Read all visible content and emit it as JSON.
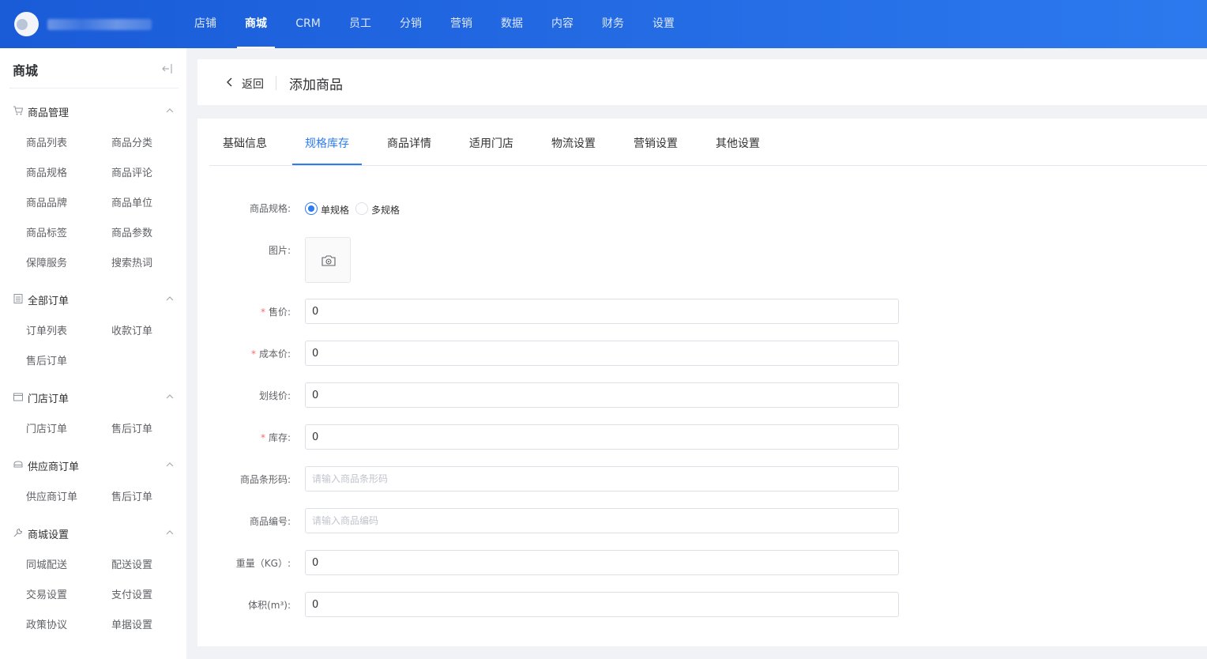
{
  "topnav": {
    "items": [
      "店铺",
      "商城",
      "CRM",
      "员工",
      "分销",
      "营销",
      "数据",
      "内容",
      "财务",
      "设置"
    ],
    "active": "商城"
  },
  "sidebar": {
    "title": "商城",
    "groups": [
      {
        "label": "商品管理",
        "icon": "cart-icon",
        "links": [
          "商品列表",
          "商品分类",
          "商品规格",
          "商品评论",
          "商品品牌",
          "商品单位",
          "商品标签",
          "商品参数",
          "保障服务",
          "搜索热词"
        ]
      },
      {
        "label": "全部订单",
        "icon": "list-icon",
        "links": [
          "订单列表",
          "收款订单",
          "售后订单"
        ]
      },
      {
        "label": "门店订单",
        "icon": "store-icon",
        "links": [
          "门店订单",
          "售后订单"
        ]
      },
      {
        "label": "供应商订单",
        "icon": "box-icon",
        "links": [
          "供应商订单",
          "售后订单"
        ]
      },
      {
        "label": "商城设置",
        "icon": "wrench-icon",
        "links": [
          "同城配送",
          "配送设置",
          "交易设置",
          "支付设置",
          "政策协议",
          "单据设置"
        ]
      }
    ]
  },
  "header": {
    "back_label": "返回",
    "title": "添加商品"
  },
  "tabs": {
    "items": [
      "基础信息",
      "规格库存",
      "商品详情",
      "适用门店",
      "物流设置",
      "营销设置",
      "其他设置"
    ],
    "active": "规格库存"
  },
  "form": {
    "spec_label": "商品规格:",
    "spec_options": [
      "单规格",
      "多规格"
    ],
    "spec_selected": "单规格",
    "image_label": "图片:",
    "price_label": "售价:",
    "price_value": "0",
    "cost_label": "成本价:",
    "cost_value": "0",
    "strike_label": "划线价:",
    "strike_value": "0",
    "stock_label": "库存:",
    "stock_value": "0",
    "barcode_label": "商品条形码:",
    "barcode_placeholder": "请输入商品条形码",
    "code_label": "商品编号:",
    "code_placeholder": "请输入商品编码",
    "weight_label": "重量（KG）:",
    "weight_value": "0",
    "volume_label": "体积(m³):",
    "volume_value": "0"
  },
  "colors": {
    "primary": "#2d7cf0",
    "topbar_start": "#1a5bd8",
    "topbar_end": "#2c79ee",
    "required": "#f56c6c"
  }
}
